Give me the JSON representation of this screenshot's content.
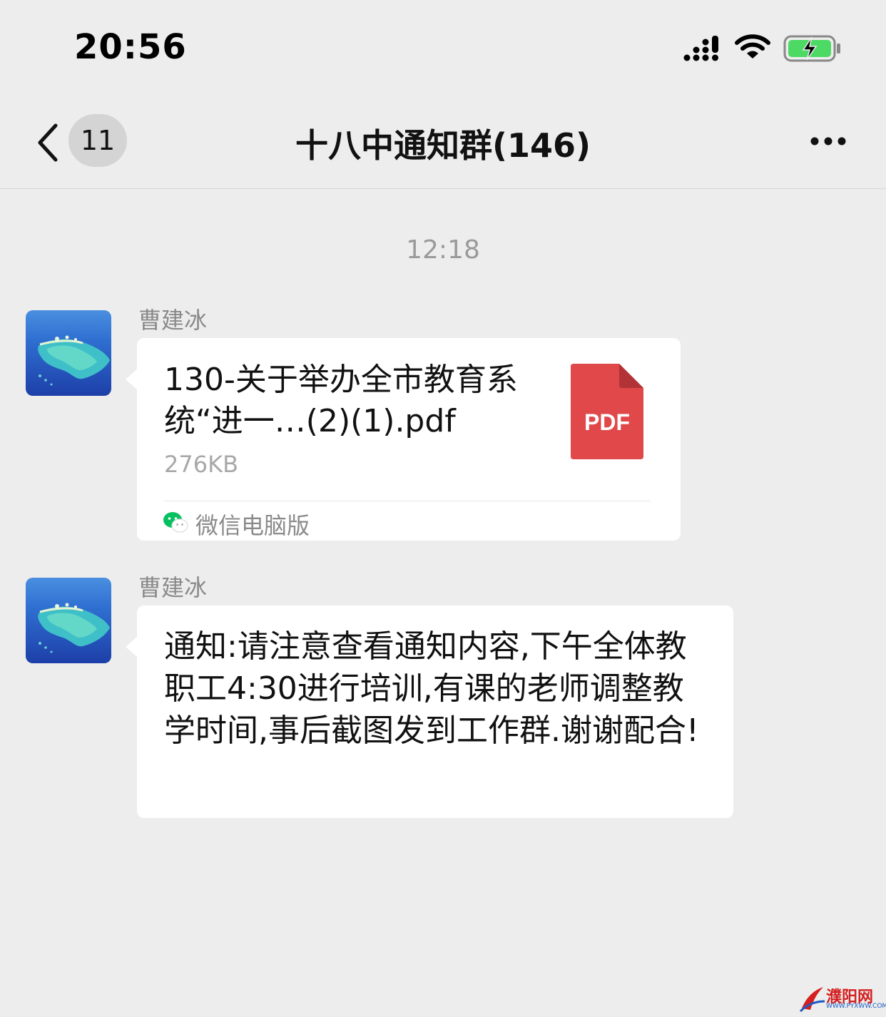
{
  "status_bar": {
    "time": "20:56"
  },
  "header": {
    "unread_count": "11",
    "title": "十八中通知群(146)"
  },
  "chat": {
    "timestamp": "12:18",
    "messages": [
      {
        "type": "file",
        "sender": "曹建冰",
        "file_name": "130-关于举办全市教育系统“进一…(2)(1).pdf",
        "file_size": "276KB",
        "file_type_label": "PDF",
        "source_label": "微信电脑版"
      },
      {
        "type": "text",
        "sender": "曹建冰",
        "text": "通知:请注意查看通知内容,下午全体教职工4:30进行培训,有课的老师调整教学时间,事后截图发到工作群.谢谢配合!"
      }
    ]
  },
  "watermark": {
    "text": "濮阳网",
    "url": "WWW.PYXWW.COM"
  },
  "icons": {
    "back": "chevron-left-icon",
    "more": "more-dots-icon",
    "signal": "cellular-signal-icon",
    "wifi": "wifi-icon",
    "battery": "battery-charging-icon",
    "file": "pdf-file-icon",
    "source": "wechat-icon"
  },
  "colors": {
    "background": "#ededed",
    "bubble": "#ffffff",
    "pdf_red": "#e0484a",
    "wechat_green": "#07c160",
    "battery_green": "#4cd964"
  }
}
